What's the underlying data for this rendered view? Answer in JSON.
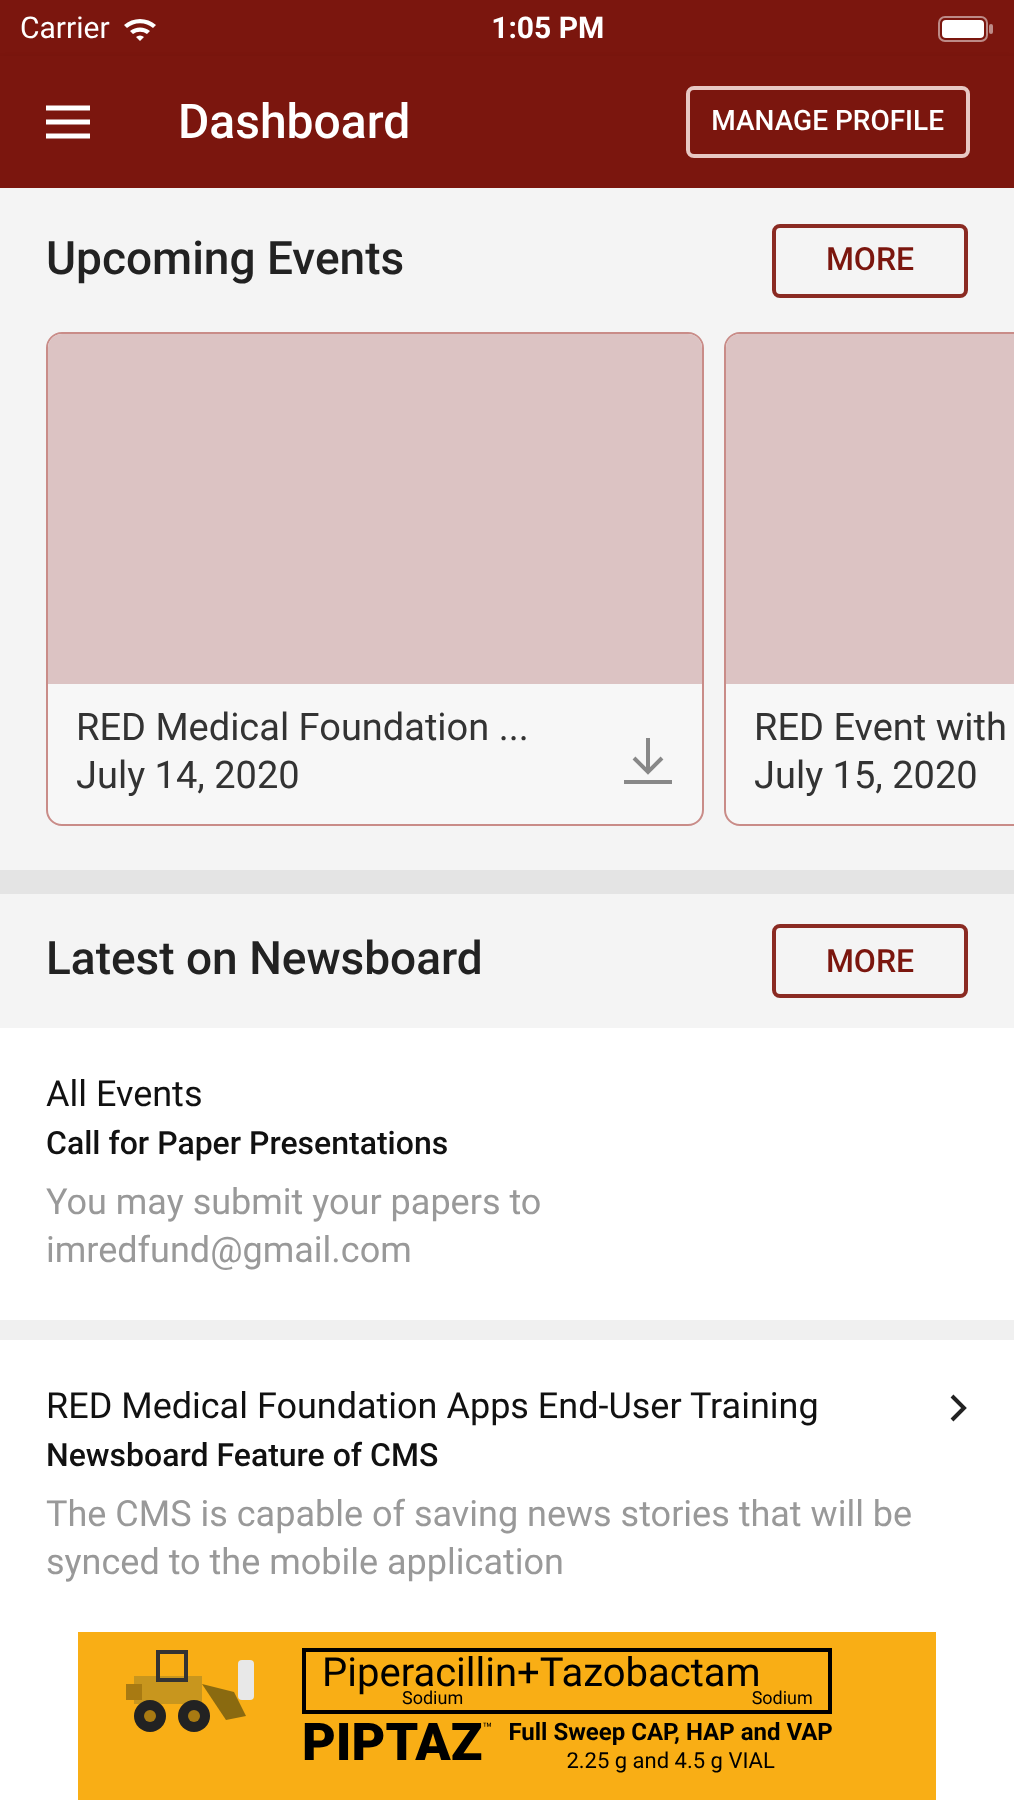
{
  "status_bar": {
    "carrier": "Carrier",
    "time": "1:05 PM"
  },
  "header": {
    "title": "Dashboard",
    "action": "MANAGE PROFILE"
  },
  "upcoming": {
    "title": "Upcoming Events",
    "more": "MORE",
    "events": [
      {
        "title": "RED Medical Foundation ...",
        "date": "July 14, 2020",
        "downloadable": true
      },
      {
        "title": "RED Event with",
        "date": "July 15, 2020"
      }
    ]
  },
  "newsboard": {
    "title": "Latest on Newsboard",
    "more": "MORE",
    "items": [
      {
        "category": "All Events",
        "headline": "Call for Paper Presentations",
        "summary": "You may submit your papers to\nimredfund@gmail.com",
        "has_chevron": false
      },
      {
        "category": "RED Medical Foundation Apps End-User Training",
        "headline": "Newsboard Feature of CMS",
        "summary": "The CMS is capable of saving news stories that will be synced to the mobile application",
        "has_chevron": true
      }
    ]
  },
  "banner": {
    "drug": "Piperacillin+Tazobactam",
    "salt_1": "Sodium",
    "salt_2": "Sodium",
    "brand": "PIPTAZ",
    "trademark": "™",
    "tagline": "Full Sweep CAP, HAP and VAP",
    "dose": "2.25 g and 4.5 g VIAL"
  }
}
